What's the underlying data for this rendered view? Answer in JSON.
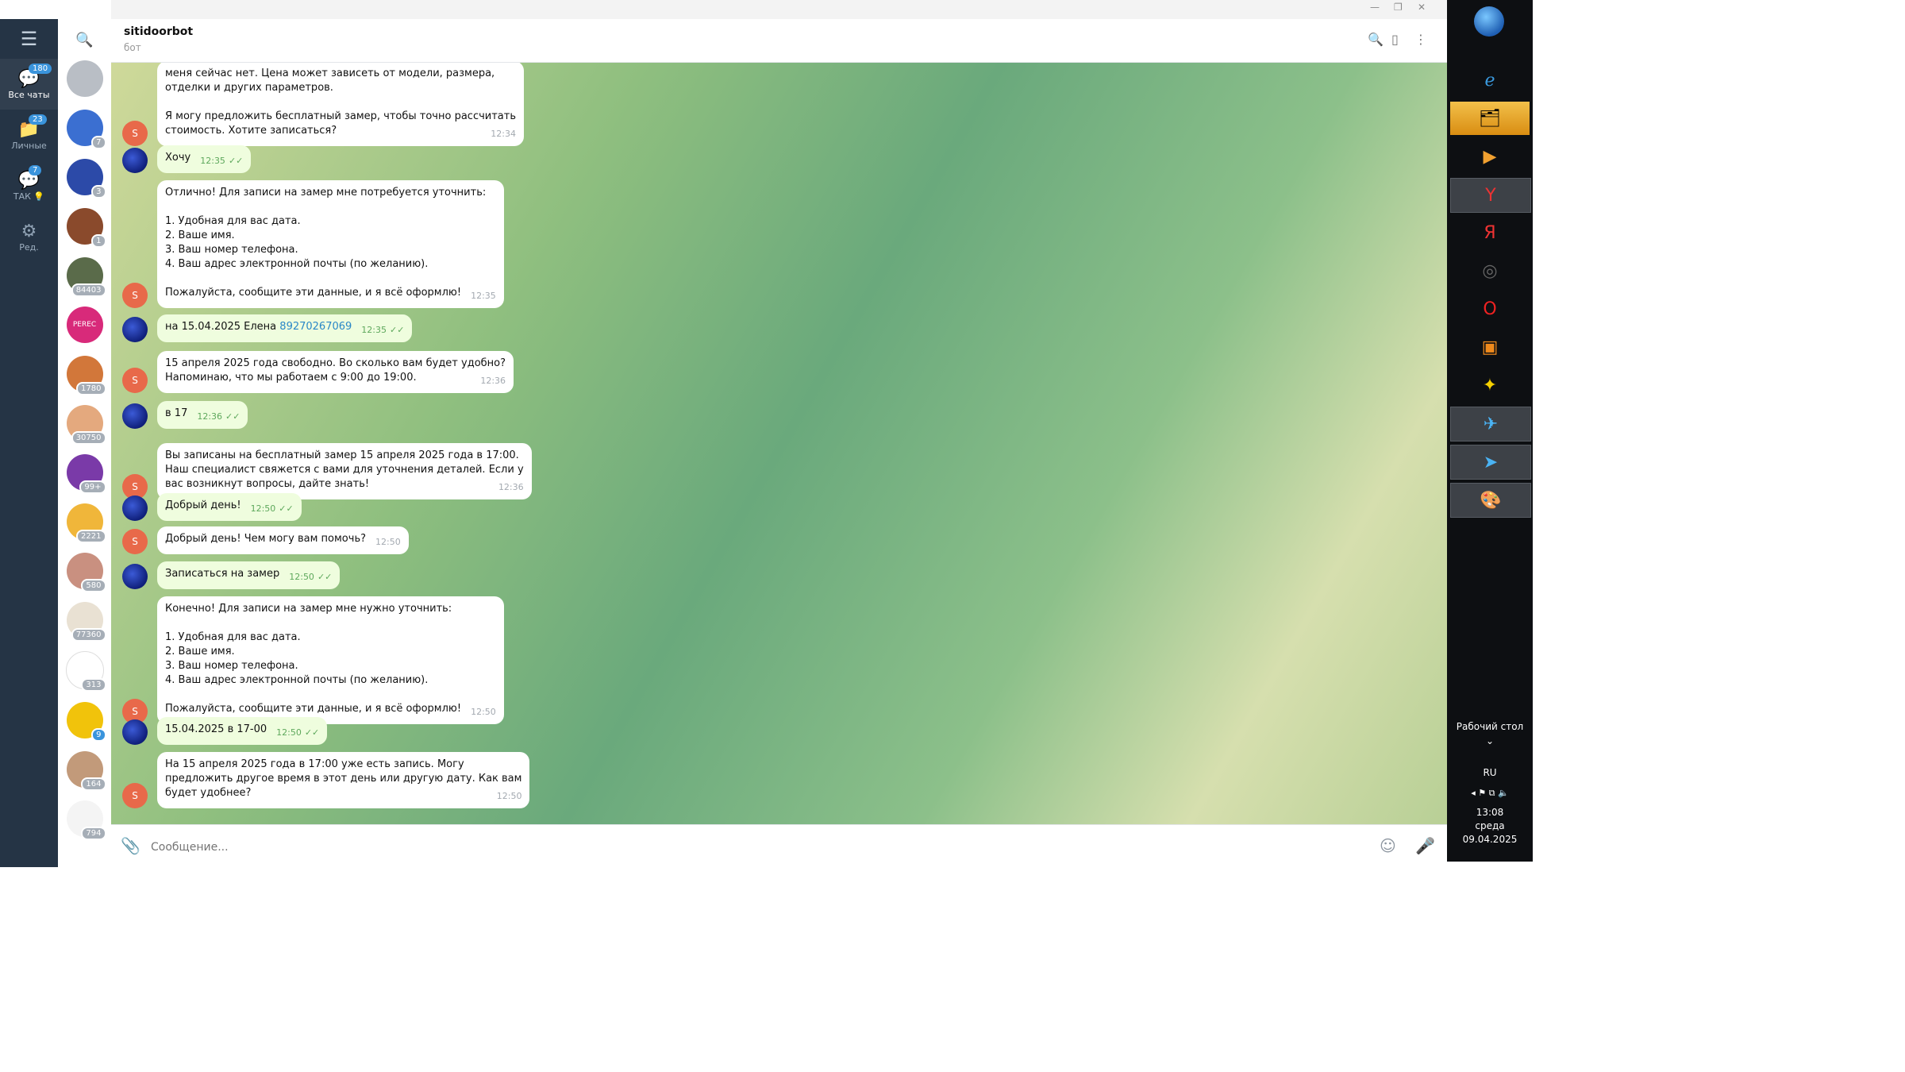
{
  "window": {
    "title": "sitidoorbot",
    "subtitle": "бот"
  },
  "rail": {
    "folders": [
      {
        "label": "Все чаты",
        "badge": "180"
      },
      {
        "label": "Личные",
        "badge": "23"
      },
      {
        "label": "ТАК 💡",
        "badge": "7"
      },
      {
        "label": "Ред.",
        "badge": ""
      }
    ]
  },
  "chat_list_badges": [
    "7",
    "3",
    "1",
    "84403",
    "",
    "1780",
    "30750",
    "99+",
    "2221",
    "580",
    "77360",
    "313",
    "9",
    "164",
    "794"
  ],
  "chat_list_text": {
    "perec": "PEREC"
  },
  "messages": [
    {
      "from": "bot",
      "text": "меня сейчас нет. Цена может зависеть от модели, размера,\nотделки и других параметров.\n\nЯ могу предложить бесплатный замер, чтобы точно рассчитать\nстоимость. Хотите записаться?",
      "time": "12:34"
    },
    {
      "from": "user",
      "text": "Хочу",
      "time": "12:35"
    },
    {
      "from": "bot",
      "text": "Отлично! Для записи на замер мне потребуется уточнить:\n\n1. Удобная для вас дата.\n2. Ваше имя.\n3. Ваш номер телефона.\n4. Ваш адрес электронной почты (по желанию).\n\nПожалуйста, сообщите эти данные, и я всё оформлю!",
      "time": "12:35"
    },
    {
      "from": "user",
      "text": "на 15.04.2025  Елена ",
      "link": "89270267069",
      "time": "12:35"
    },
    {
      "from": "bot",
      "text": "15 апреля 2025 года свободно. Во сколько вам будет удобно?\nНапоминаю, что мы работаем с 9:00 до 19:00.",
      "time": "12:36"
    },
    {
      "from": "user",
      "text": "в 17",
      "time": "12:36"
    },
    {
      "from": "bot",
      "text": "Вы записаны на бесплатный замер 15 апреля 2025 года в 17:00.\nНаш специалист свяжется с вами для уточнения деталей. Если у\nвас возникнут вопросы, дайте знать!",
      "time": "12:36"
    },
    {
      "from": "user",
      "text": "Добрый день!",
      "time": "12:50"
    },
    {
      "from": "bot",
      "text": "Добрый день! Чем могу вам помочь?",
      "time": "12:50"
    },
    {
      "from": "user",
      "text": "Записаться на замер",
      "time": "12:50"
    },
    {
      "from": "bot",
      "text": "Конечно! Для записи на замер мне нужно уточнить:\n\n1. Удобная для вас дата.\n2. Ваше имя.\n3. Ваш номер телефона.\n4. Ваш адрес электронной почты (по желанию).\n\nПожалуйста, сообщите эти данные, и я всё оформлю!",
      "time": "12:50"
    },
    {
      "from": "user",
      "text": "15.04.2025 в 17-00",
      "time": "12:50"
    },
    {
      "from": "bot",
      "text": "На 15 апреля 2025 года в 17:00 уже есть запись. Могу\nпредложить другое время в этот день или другую дату. Как вам\nбудет удобнее?",
      "time": "12:50"
    }
  ],
  "bot_avatar_letter": "S",
  "input": {
    "placeholder": "Сообщение..."
  },
  "taskbar": {
    "desktop_label": "Рабочий стол",
    "lang": "RU",
    "time": "13:08",
    "weekday": "среда",
    "date": "09.04.2025"
  },
  "colors": {
    "rail": "#253445",
    "accent": "#3a94dc",
    "outgoing": "#effdde",
    "bot_avatar": "#e8694a"
  }
}
